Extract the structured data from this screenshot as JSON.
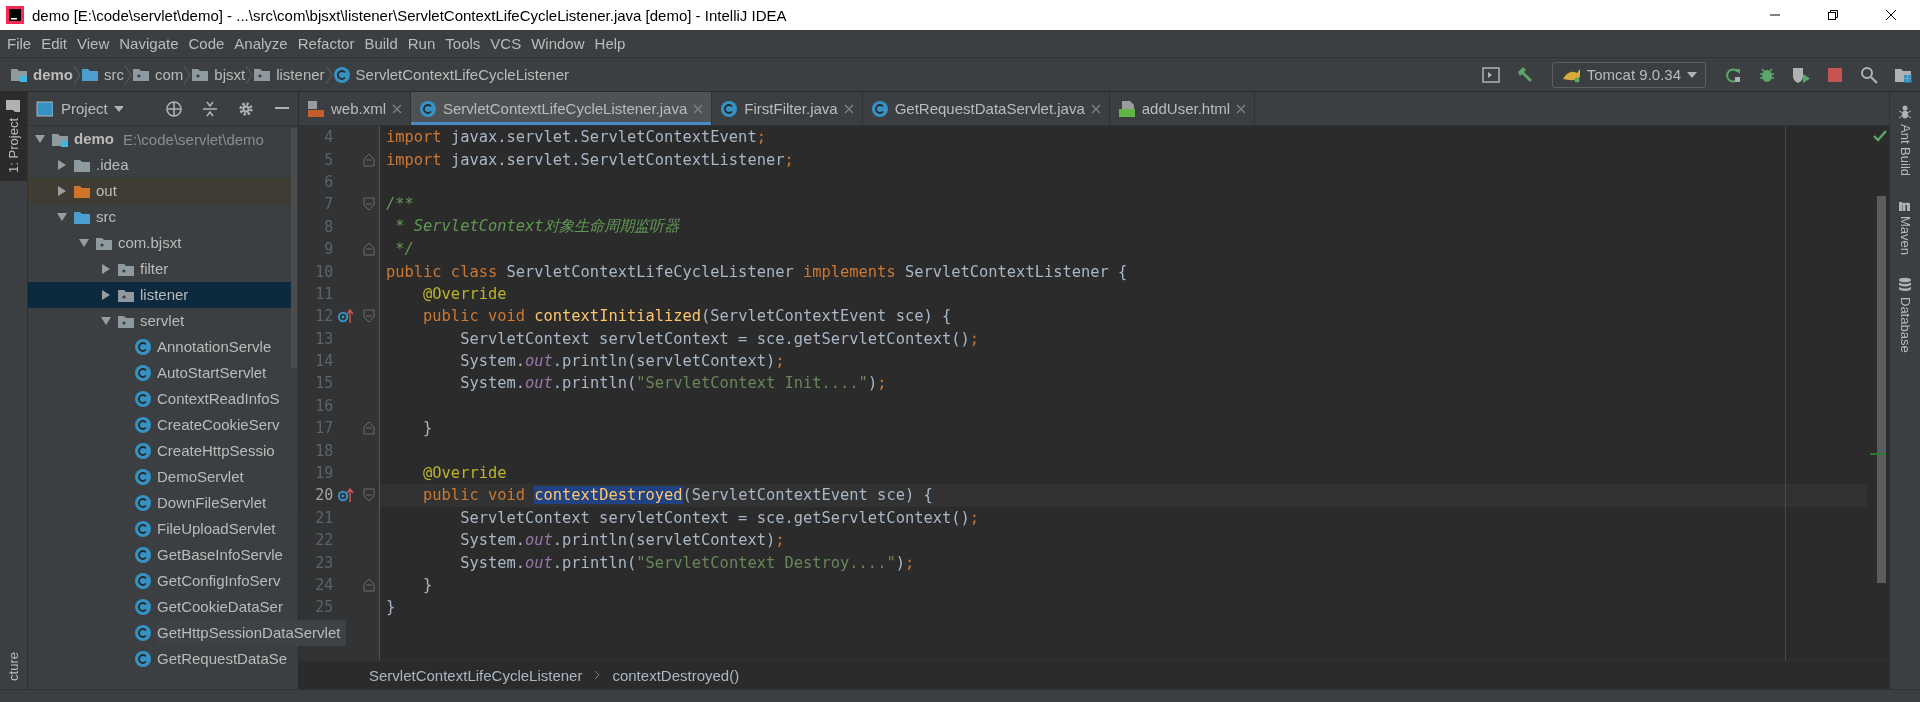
{
  "window": {
    "title": "demo [E:\\code\\servlet\\demo] - ...\\src\\com\\bjsxt\\listener\\ServletContextLifeCycleListener.java [demo] - IntelliJ IDEA"
  },
  "menu": [
    "File",
    "Edit",
    "View",
    "Navigate",
    "Code",
    "Analyze",
    "Refactor",
    "Build",
    "Run",
    "Tools",
    "VCS",
    "Window",
    "Help"
  ],
  "breadcrumb": [
    {
      "label": "demo",
      "kind": "module"
    },
    {
      "label": "src",
      "kind": "source"
    },
    {
      "label": "com",
      "kind": "package"
    },
    {
      "label": "bjsxt",
      "kind": "package"
    },
    {
      "label": "listener",
      "kind": "package"
    },
    {
      "label": "ServletContextLifeCycleListener",
      "kind": "class"
    }
  ],
  "run_config": "Tomcat 9.0.34",
  "left_stripe": [
    {
      "label": "1: Project",
      "selected": true
    },
    {
      "label": "cture",
      "selected": false
    }
  ],
  "project_panel": {
    "title": "Project",
    "tree": [
      {
        "label": "demo",
        "path": "E:\\code\\servlet\\demo",
        "kind": "module",
        "expanded": true,
        "selected": false,
        "children": [
          {
            "label": ".idea",
            "kind": "folder",
            "expanded": false,
            "selected": false
          },
          {
            "label": "out",
            "kind": "excluded",
            "expanded": false,
            "selected": false
          },
          {
            "label": "src",
            "kind": "source",
            "expanded": true,
            "selected": false,
            "children": [
              {
                "label": "com.bjsxt",
                "kind": "package",
                "expanded": true,
                "selected": false,
                "children": [
                  {
                    "label": "filter",
                    "kind": "package",
                    "expanded": false,
                    "selected": false
                  },
                  {
                    "label": "listener",
                    "kind": "package",
                    "expanded": false,
                    "selected": true
                  },
                  {
                    "label": "servlet",
                    "kind": "package",
                    "expanded": true,
                    "selected": false,
                    "children": [
                      {
                        "label": "AnnotationServle",
                        "kind": "class",
                        "selected": false,
                        "hovered": false
                      },
                      {
                        "label": "AutoStartServlet",
                        "kind": "class",
                        "selected": false,
                        "hovered": false
                      },
                      {
                        "label": "ContextReadInfoS",
                        "kind": "class",
                        "selected": false,
                        "hovered": false
                      },
                      {
                        "label": "CreateCookieServ",
                        "kind": "class",
                        "selected": false,
                        "hovered": false
                      },
                      {
                        "label": "CreateHttpSessio",
                        "kind": "class",
                        "selected": false,
                        "hovered": false
                      },
                      {
                        "label": "DemoServlet",
                        "kind": "class",
                        "selected": false,
                        "hovered": false
                      },
                      {
                        "label": "DownFileServlet",
                        "kind": "class",
                        "selected": false,
                        "hovered": false
                      },
                      {
                        "label": "FileUploadServlet",
                        "kind": "class",
                        "selected": false,
                        "hovered": false
                      },
                      {
                        "label": "GetBaseInfoServle",
                        "kind": "class",
                        "selected": false,
                        "hovered": false
                      },
                      {
                        "label": "GetConfigInfoServ",
                        "kind": "class",
                        "selected": false,
                        "hovered": false
                      },
                      {
                        "label": "GetCookieDataSer",
                        "kind": "class",
                        "selected": false,
                        "hovered": false
                      },
                      {
                        "label": "GetHttpSessionDataServlet",
                        "kind": "class",
                        "selected": false,
                        "hovered": true
                      },
                      {
                        "label": "GetRequestDataSe",
                        "kind": "class",
                        "selected": false,
                        "hovered": false
                      }
                    ]
                  }
                ]
              }
            ]
          }
        ]
      }
    ]
  },
  "tabs": [
    {
      "label": "web.xml",
      "kind": "xml",
      "selected": false
    },
    {
      "label": "ServletContextLifeCycleListener.java",
      "kind": "class",
      "selected": true
    },
    {
      "label": "FirstFilter.java",
      "kind": "class",
      "selected": false
    },
    {
      "label": "GetRequestDataServlet.java",
      "kind": "class",
      "selected": false
    },
    {
      "label": "addUser.html",
      "kind": "html",
      "selected": false
    }
  ],
  "code_lines": [
    {
      "number": "4",
      "current": false,
      "tokens": [
        {
          "text": "import",
          "kind": "keyword"
        },
        {
          "text": " javax.servlet.ServletContextEvent",
          "kind": "plain"
        },
        {
          "text": ";",
          "kind": "keyword"
        }
      ]
    },
    {
      "number": "5",
      "current": false,
      "gutter_marks": [
        {
          "kind": "fold_end"
        }
      ],
      "tokens": [
        {
          "text": "import",
          "kind": "keyword"
        },
        {
          "text": " javax.servlet.ServletContextListener",
          "kind": "plain"
        },
        {
          "text": ";",
          "kind": "keyword"
        }
      ]
    },
    {
      "number": "6",
      "current": false
    },
    {
      "number": "7",
      "current": false,
      "gutter_marks": [
        {
          "kind": "fold_start"
        }
      ],
      "tokens": [
        {
          "text": "/**",
          "kind": "comment"
        }
      ]
    },
    {
      "number": "8",
      "current": false,
      "tokens": [
        {
          "text": " * ServletContext对象生命周期监听器",
          "kind": "comment"
        }
      ]
    },
    {
      "number": "9",
      "current": false,
      "gutter_marks": [
        {
          "kind": "fold_end"
        }
      ],
      "tokens": [
        {
          "text": " */",
          "kind": "comment"
        }
      ]
    },
    {
      "number": "10",
      "current": false,
      "tokens": [
        {
          "text": "public class ",
          "kind": "keyword"
        },
        {
          "text": "ServletContextLifeCycleListener ",
          "kind": "plain"
        },
        {
          "text": "implements ",
          "kind": "keyword"
        },
        {
          "text": "ServletContextListener {",
          "kind": "plain"
        }
      ]
    },
    {
      "number": "11",
      "current": false,
      "tokens": [
        {
          "text": "    @Override",
          "kind": "annotation"
        }
      ]
    },
    {
      "number": "12",
      "current": false,
      "gutter_marks": [
        {
          "kind": "override"
        },
        {
          "kind": "fold_start"
        }
      ],
      "tokens": [
        {
          "text": "    public void ",
          "kind": "keyword"
        },
        {
          "text": "contextInitialized",
          "kind": "method"
        },
        {
          "text": "(ServletContextEvent sce) {",
          "kind": "plain"
        }
      ]
    },
    {
      "number": "13",
      "current": false,
      "tokens": [
        {
          "text": "        ServletContext servletContext = sce.getServletContext()",
          "kind": "plain"
        },
        {
          "text": ";",
          "kind": "keyword"
        }
      ]
    },
    {
      "number": "14",
      "current": false,
      "tokens": [
        {
          "text": "        System.",
          "kind": "plain"
        },
        {
          "text": "out",
          "kind": "static"
        },
        {
          "text": ".println(servletContext)",
          "kind": "plain"
        },
        {
          "text": ";",
          "kind": "keyword"
        }
      ]
    },
    {
      "number": "15",
      "current": false,
      "tokens": [
        {
          "text": "        System.",
          "kind": "plain"
        },
        {
          "text": "out",
          "kind": "static"
        },
        {
          "text": ".println(",
          "kind": "plain"
        },
        {
          "text": "\"ServletContext Init....\"",
          "kind": "string"
        },
        {
          "text": ")",
          "kind": "plain"
        },
        {
          "text": ";",
          "kind": "keyword"
        }
      ]
    },
    {
      "number": "16",
      "current": false
    },
    {
      "number": "17",
      "current": false,
      "gutter_marks": [
        {
          "kind": "fold_end"
        }
      ],
      "tokens": [
        {
          "text": "    }",
          "kind": "plain"
        }
      ]
    },
    {
      "number": "18",
      "current": false
    },
    {
      "number": "19",
      "current": false,
      "tokens": [
        {
          "text": "    @Override",
          "kind": "annotation"
        }
      ]
    },
    {
      "number": "20",
      "current": true,
      "gutter_marks": [
        {
          "kind": "override"
        },
        {
          "kind": "fold_start"
        }
      ],
      "tokens": [
        {
          "text": "    public void ",
          "kind": "keyword"
        },
        {
          "text": "contextDestroyed",
          "kind": "method_highlighted"
        },
        {
          "text": "(ServletContextEvent sce) {",
          "kind": "plain"
        }
      ]
    },
    {
      "number": "21",
      "current": false,
      "tokens": [
        {
          "text": "        ServletContext servletContext = sce.getServletContext()",
          "kind": "plain"
        },
        {
          "text": ";",
          "kind": "keyword"
        }
      ]
    },
    {
      "number": "22",
      "current": false,
      "tokens": [
        {
          "text": "        System.",
          "kind": "plain"
        },
        {
          "text": "out",
          "kind": "static"
        },
        {
          "text": ".println(servletContext)",
          "kind": "plain"
        },
        {
          "text": ";",
          "kind": "keyword"
        }
      ]
    },
    {
      "number": "23",
      "current": false,
      "tokens": [
        {
          "text": "        System.",
          "kind": "plain"
        },
        {
          "text": "out",
          "kind": "static"
        },
        {
          "text": ".println(",
          "kind": "plain"
        },
        {
          "text": "\"ServletContext Destroy....\"",
          "kind": "string"
        },
        {
          "text": ")",
          "kind": "plain"
        },
        {
          "text": ";",
          "kind": "keyword"
        }
      ]
    },
    {
      "number": "24",
      "current": false,
      "gutter_marks": [
        {
          "kind": "fold_end"
        }
      ],
      "tokens": [
        {
          "text": "    }",
          "kind": "plain"
        }
      ]
    },
    {
      "number": "25",
      "current": false,
      "tokens": [
        {
          "text": "}",
          "kind": "plain"
        }
      ]
    }
  ],
  "editor_breadcrumb": [
    "ServletContextLifeCycleListener",
    "contextDestroyed()"
  ],
  "right_stripe": [
    {
      "label": "Ant Build",
      "kind": "ant"
    },
    {
      "label": "Maven",
      "kind": "maven"
    },
    {
      "label": "Database",
      "kind": "database"
    }
  ]
}
